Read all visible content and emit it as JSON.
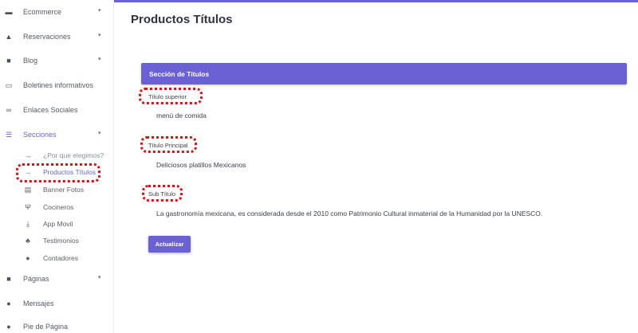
{
  "sidebar": {
    "items": [
      {
        "label": "Ecommerce",
        "icon": "store-icon",
        "glyph": "▬",
        "has_chevron": true
      },
      {
        "label": "Reservaciones",
        "icon": "bell-icon",
        "glyph": "▲",
        "has_chevron": true
      },
      {
        "label": "Blog",
        "icon": "blog-icon",
        "glyph": "■",
        "has_chevron": true
      },
      {
        "label": "Boletines informativos",
        "icon": "newsletter-icon",
        "glyph": "▭",
        "has_chevron": false
      },
      {
        "label": "Enlaces Sociales",
        "icon": "link-icon",
        "glyph": "∞",
        "has_chevron": false
      },
      {
        "label": "Secciones",
        "icon": "bars-icon",
        "glyph": "☰",
        "has_chevron": true,
        "active": true
      },
      {
        "label": "Páginas",
        "icon": "file-icon",
        "glyph": "■",
        "has_chevron": true
      },
      {
        "label": "Mensajes",
        "icon": "chat-icon",
        "glyph": "●",
        "has_chevron": false
      },
      {
        "label": "Pie de Página",
        "icon": "info-icon",
        "glyph": "●",
        "has_chevron": false
      }
    ],
    "chevron_glyph": "▾",
    "sub_items": [
      {
        "label": "¿Por que elegimos?",
        "icon": "arrow-right-icon",
        "glyph": "→"
      },
      {
        "label": "Productos Títulos",
        "icon": "arrow-right-icon",
        "glyph": "→",
        "active": true
      },
      {
        "label": "Banner Fotos",
        "icon": "images-icon",
        "glyph": "▤"
      },
      {
        "label": "Cocineros",
        "icon": "utensils-icon",
        "glyph": "Ψ"
      },
      {
        "label": "App Movil",
        "icon": "download-icon",
        "glyph": "⤓"
      },
      {
        "label": "Testimonios",
        "icon": "users-icon",
        "glyph": "♣"
      },
      {
        "label": "Contadores",
        "icon": "comments-icon",
        "glyph": "●"
      }
    ]
  },
  "main": {
    "title": "Productos Títulos",
    "card_title": "Sección de Títulos",
    "fields": [
      {
        "label": "Título superior",
        "value": "menú de comida"
      },
      {
        "label": "Título Principal",
        "value": "Deliciosos platillos Mexicanos"
      },
      {
        "label": "Sub Título",
        "value": "La gastronomía mexicana, es considerada desde el 2010 como Patrimonio Cultural inmaterial de la Humanidad por la UNESCO."
      }
    ],
    "submit_label": "Actualizar"
  },
  "colors": {
    "accent": "#6a62d4",
    "highlight": "#e01010",
    "text": "#3c3f4c"
  }
}
